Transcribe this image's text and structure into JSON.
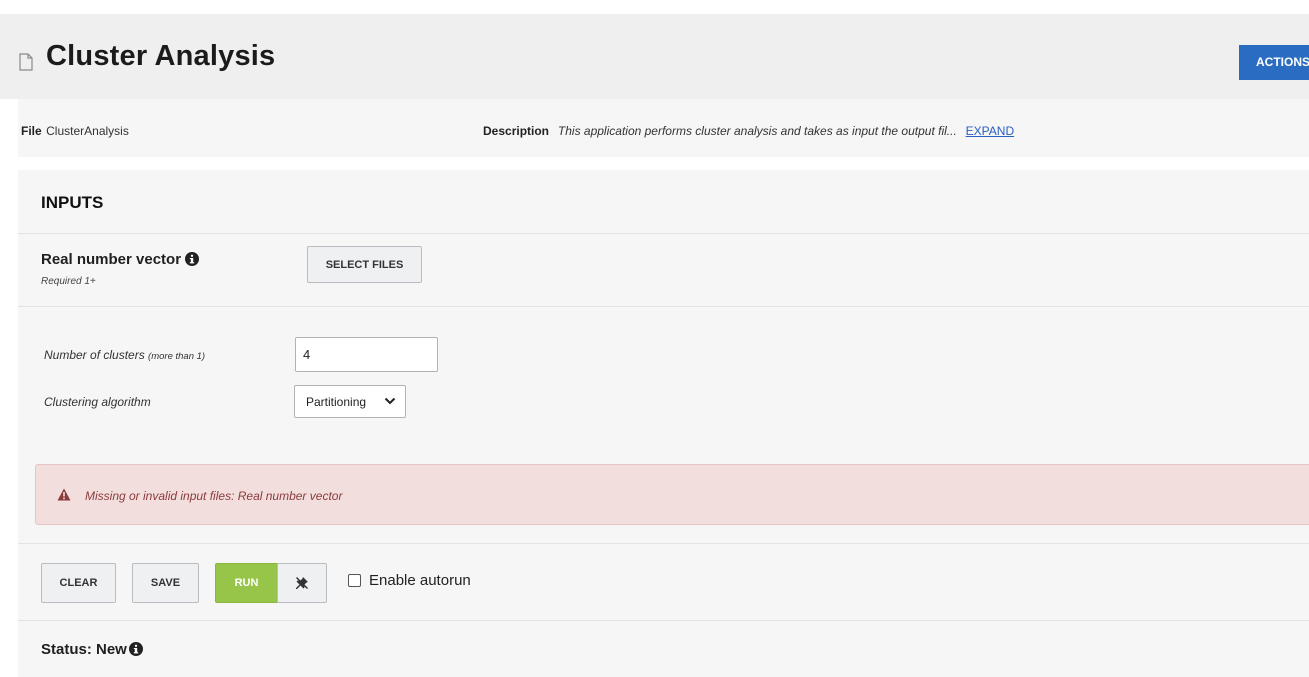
{
  "header": {
    "title": "Cluster Analysis",
    "actions_label": "ACTIONS"
  },
  "meta": {
    "file_label": "File",
    "file_value": "ClusterAnalysis",
    "description_label": "Description",
    "description_value": "This application performs cluster analysis and takes as input the output fil...",
    "expand_label": "EXPAND"
  },
  "inputs": {
    "heading": "INPUTS",
    "vector_label": "Real number vector",
    "vector_requirement": "Required 1+",
    "select_files_label": "SELECT FILES"
  },
  "params": {
    "clusters_label": "Number of clusters",
    "clusters_hint": "(more than 1)",
    "clusters_value": "4",
    "algorithm_label": "Clustering algorithm",
    "algorithm_value": "Partitioning"
  },
  "alert": {
    "message": "Missing or invalid input files: Real number vector"
  },
  "toolbar": {
    "clear_label": "CLEAR",
    "save_label": "SAVE",
    "run_label": "RUN",
    "autorun_label": "Enable autorun",
    "autorun_checked": false
  },
  "status": {
    "text": "Status: New"
  },
  "colors": {
    "primary": "#2a6cc2",
    "run": "#96c549",
    "alert_bg": "#f3dede",
    "alert_text": "#8a3b3b"
  }
}
